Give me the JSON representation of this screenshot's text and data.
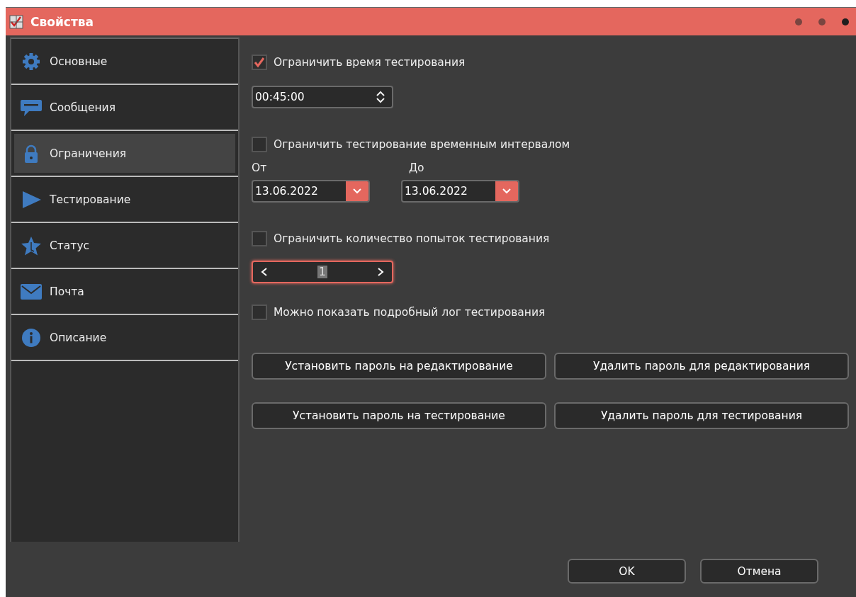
{
  "window": {
    "title": "Свойства"
  },
  "sidebar": {
    "items": [
      {
        "label": "Основные",
        "selected": false
      },
      {
        "label": "Сообщения",
        "selected": false
      },
      {
        "label": "Ограничения",
        "selected": true
      },
      {
        "label": "Тестирование",
        "selected": false
      },
      {
        "label": "Статус",
        "selected": false
      },
      {
        "label": "Почта",
        "selected": false
      },
      {
        "label": "Описание",
        "selected": false
      }
    ]
  },
  "content": {
    "time_limit": {
      "label": "Ограничить время тестирования",
      "checked": true,
      "value": "00:45:00"
    },
    "interval_limit": {
      "label": "Ограничить тестирование временным интервалом",
      "checked": false,
      "from_label": "От",
      "from": "13.06.2022",
      "to_label": "До",
      "to": "13.06.2022"
    },
    "attempts_limit": {
      "label": "Ограничить количество попыток тестирования",
      "checked": false,
      "value": "1",
      "focused": true
    },
    "show_log": {
      "label": "Можно показать подробный лог тестирования",
      "checked": false
    },
    "password_buttons": [
      "Установить пароль на редактирование",
      "Удалить пароль для редактирования",
      "Установить пароль на тестирование",
      "Удалить пароль для тестирования"
    ]
  },
  "footer": {
    "buttons": [
      "OK",
      "Отмена"
    ]
  }
}
